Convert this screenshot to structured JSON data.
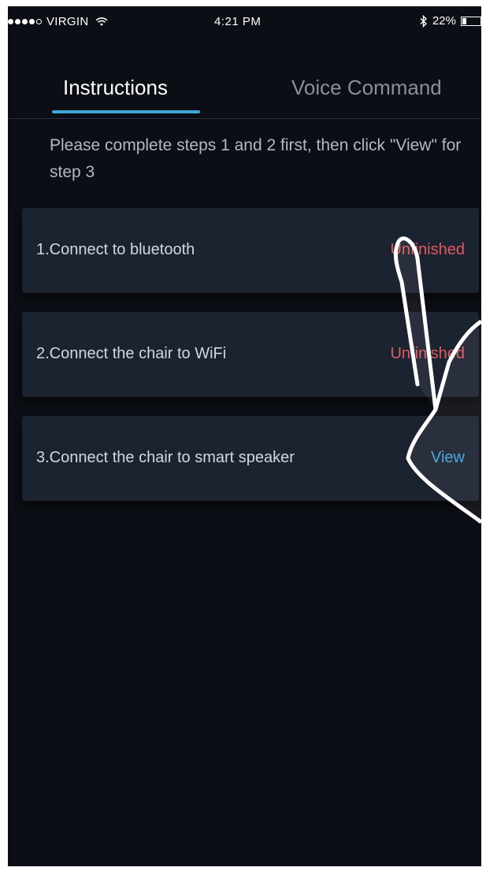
{
  "status_bar": {
    "carrier": "VIRGIN",
    "time": "4:21 PM",
    "battery": "22%",
    "battery_level": 0.22
  },
  "tabs": [
    {
      "label": "Instructions",
      "active": true
    },
    {
      "label": "Voice Command",
      "active": false
    }
  ],
  "instruction": "Please complete steps 1 and 2 first, then click \"View\" for step 3",
  "steps": [
    {
      "label": "1.Connect to bluetooth",
      "status": "Unfinished"
    },
    {
      "label": "2.Connect the chair to WiFi",
      "status": "Unfinished"
    },
    {
      "label": "3.Connect the chair to smart speaker",
      "status": "View"
    }
  ],
  "colors": {
    "background": "#0c0e15",
    "card": "#1c2330",
    "accent": "#3fa8d8",
    "unfinished": "#e05a5e",
    "inactive_tab": "#8a8f99"
  },
  "icons": [
    "wifi-icon",
    "bluetooth-icon",
    "battery-icon",
    "pointing-hand-icon"
  ]
}
